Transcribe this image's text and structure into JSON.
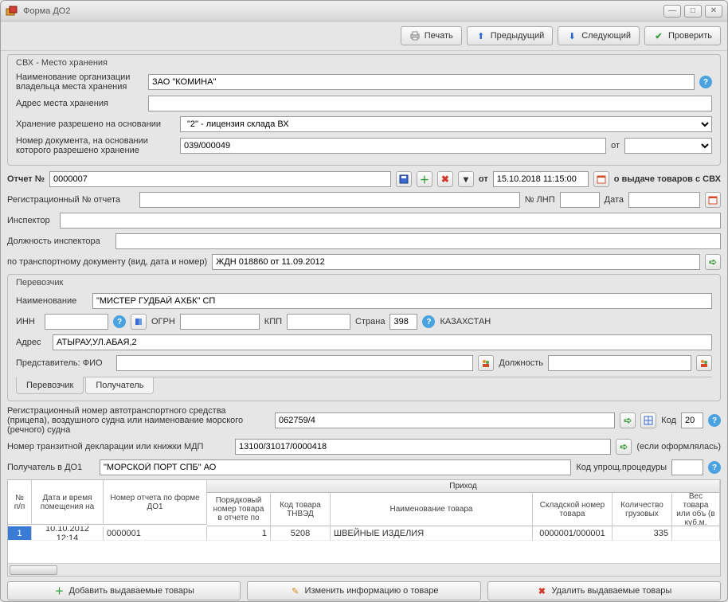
{
  "window": {
    "title": "Форма ДО2"
  },
  "toolbar": {
    "print": "Печать",
    "prev": "Предыдущий",
    "next": "Следующий",
    "check": "Проверить"
  },
  "svh": {
    "panel_title": "СВХ - Место хранения",
    "org_label": "Наименование организации владельца места хранения",
    "org_value": "ЗАО \"КОМИНА\"",
    "address_label": "Адрес места хранения",
    "address_value": "",
    "permit_label": "Хранение разрешено на основании",
    "permit_value": "\"2\" - лицензия склада ВХ",
    "docnum_label": "Номер документа, на основании которого разрешено хранение",
    "docnum_value": "039/000049",
    "from_label": "от",
    "from_value": ""
  },
  "report": {
    "num_label": "Отчет №",
    "num_value": "0000007",
    "from_label": "от",
    "date_value": "15.10.2018 11:15:00",
    "suffix": "о выдаче товаров с СВХ",
    "reg_label": "Регистрационный № отчета",
    "reg_value": "",
    "lnp_label": "№ ЛНП",
    "lnp_value": "",
    "date2_label": "Дата",
    "date2_value": "",
    "inspector_label": "Инспектор",
    "inspector_value": "",
    "position_label": "Должность инспектора",
    "position_value": "",
    "transport_label": "по транспортному документу (вид, дата и номер)",
    "transport_value": "ЖДН 018860 от 11.09.2012"
  },
  "carrier": {
    "panel_title": "Перевозчик",
    "name_label": "Наименование",
    "name_value": "\"МИСТЕР ГУДБАЙ АХБК\" СП",
    "inn_label": "ИНН",
    "inn_value": "",
    "ogrn_label": "ОГРН",
    "ogrn_value": "",
    "kpp_label": "КПП",
    "kpp_value": "",
    "country_label": "Страна",
    "country_code": "398",
    "country_name": "КАЗАХСТАН",
    "address_label": "Адрес",
    "address_value": "АТЫРАУ,УЛ.АБАЯ,2",
    "rep_label": "Представитель: ФИО",
    "rep_value": "",
    "rep_pos_label": "Должность",
    "rep_pos_value": "",
    "tab_carrier": "Перевозчик",
    "tab_recipient": "Получатель"
  },
  "vehicle": {
    "reg_label": "Регистрационный номер автотранспортного средства (прицепа), воздушного судна или наименование морского (речного) судна",
    "reg_value": "062759/4",
    "code_label": "Код",
    "code_value": "20",
    "transit_label": "Номер транзитной декларации или книжки МДП",
    "transit_value": "13100/31017/0000418",
    "transit_note": "(если оформлялась)",
    "recipient_label": "Получатель в ДО1",
    "recipient_value": "\"МОРСКОЙ ПОРТ СПБ\" АО",
    "simpl_label": "Код упрощ.процедуры",
    "simpl_value": ""
  },
  "table": {
    "group_incoming": "Приход",
    "h_num": "№ п/п",
    "h_datetime": "Дата и время помещения на",
    "h_do1": "Номер отчета по форме ДО1",
    "h_seq": "Порядковый номер товара в отчете по",
    "h_tnved": "Код товара ТНВЭД",
    "h_name": "Наименование товара",
    "h_sklad": "Складской номер товара",
    "h_qty": "Количество грузовых",
    "h_weight": "Вес товара или объ (в куб.м.",
    "rows": [
      {
        "num": "1",
        "dt": "10.10.2012 12:14",
        "do1": "0000001",
        "seq": "1",
        "tnved": "5208",
        "name": "ШВЕЙНЫЕ  ИЗДЕЛИЯ",
        "sklad": "0000001/000001",
        "qty": "335",
        "weight": ""
      }
    ]
  },
  "footer": {
    "add": "Добавить выдаваемые товары",
    "edit": "Изменить информацию о товаре",
    "del": "Удалить выдаваемые товары"
  }
}
